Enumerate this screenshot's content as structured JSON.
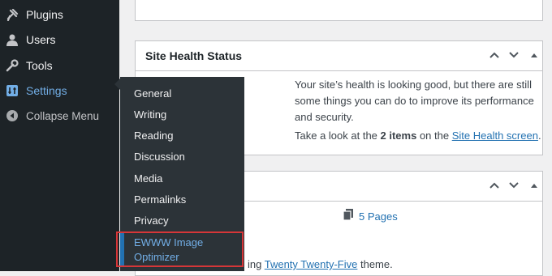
{
  "sidebar": {
    "items": [
      {
        "label": "Plugins",
        "icon": "plugin-icon"
      },
      {
        "label": "Users",
        "icon": "users-icon"
      },
      {
        "label": "Tools",
        "icon": "wrench-icon"
      },
      {
        "label": "Settings",
        "icon": "settings-icon"
      },
      {
        "label": "Collapse Menu",
        "icon": "collapse-icon"
      }
    ]
  },
  "settings_menu": {
    "items": [
      "General",
      "Writing",
      "Reading",
      "Discussion",
      "Media",
      "Permalinks",
      "Privacy"
    ],
    "highlighted": {
      "line1": "EWWW Image",
      "line2": "Optimizer"
    }
  },
  "site_health": {
    "title": "Site Health Status",
    "message": "Your site’s health is looking good, but there are still some things you can do to improve its performance and security.",
    "pre": "Take a look at the ",
    "count": "2 items",
    "mid": " on the ",
    "link": "Site Health screen",
    "post": "."
  },
  "glance": {
    "pages": "5 Pages",
    "theme_pre": "ing ",
    "theme_link": "Twenty Twenty-Five",
    "theme_post": " theme."
  },
  "colors": {
    "sidebar_bg": "#1d2327",
    "flyout_bg": "#2c3338",
    "accent": "#72aee6",
    "link": "#2271b1",
    "highlight": "#d63638"
  }
}
